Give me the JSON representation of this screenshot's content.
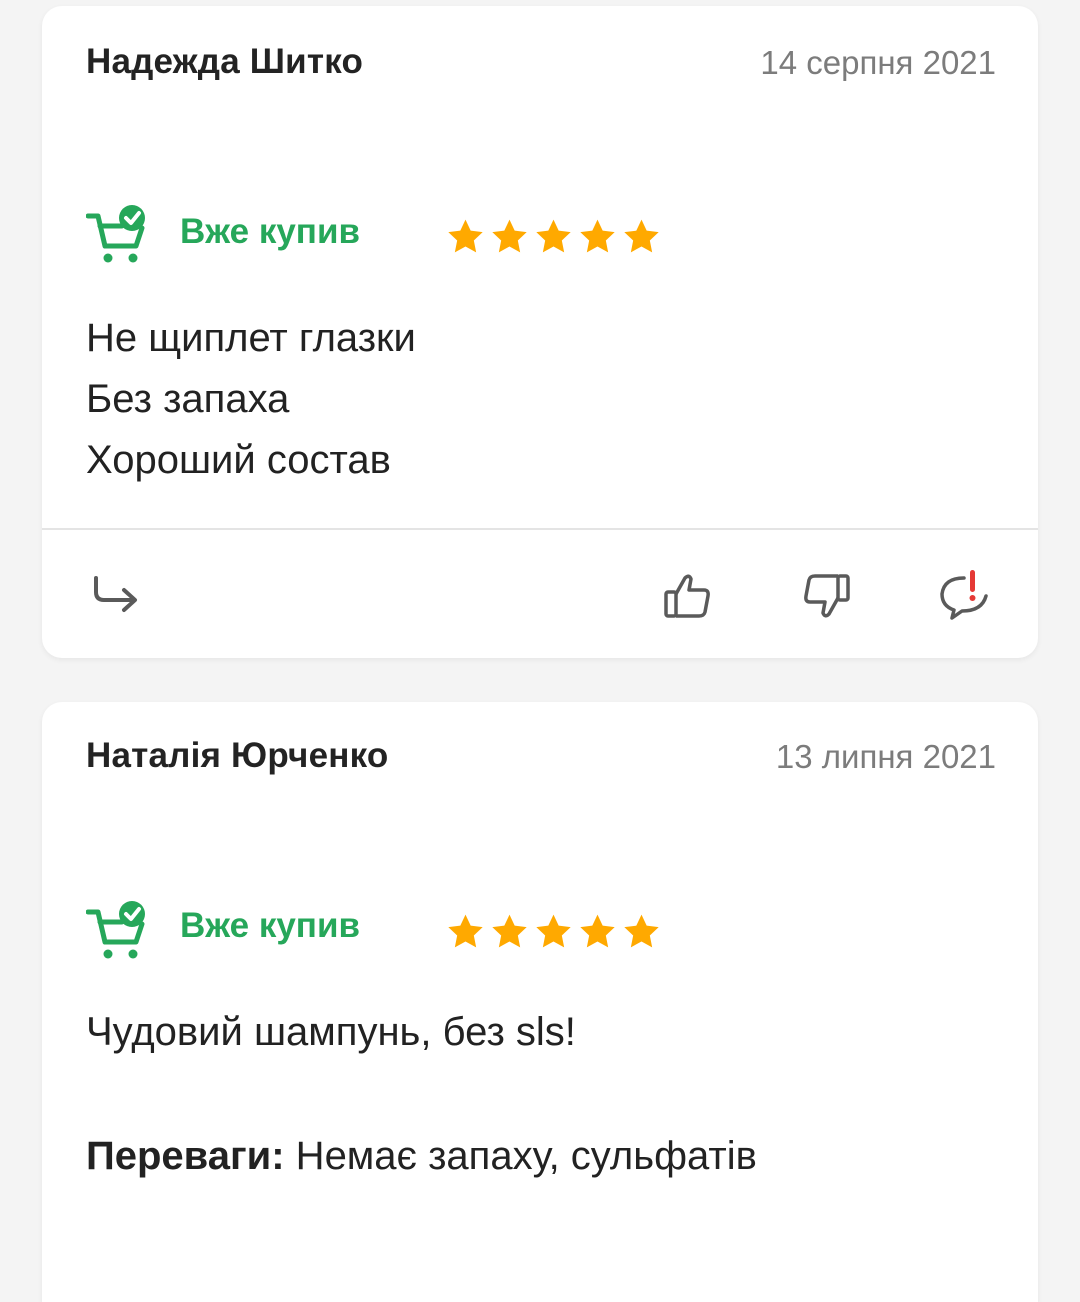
{
  "reviews": [
    {
      "author": "Надежда Шитко",
      "date": "14 серпня 2021",
      "badge": "Вже купив",
      "rating": 5,
      "lines": [
        "Не щиплет глазки",
        "Без запаха",
        "Хороший состав"
      ]
    },
    {
      "author": "Наталія Юрченко",
      "date": "13 липня 2021",
      "badge": "Вже купив",
      "rating": 5,
      "lines": [
        "Чудовий шампунь, без sls!"
      ],
      "pros_label": "Переваги:",
      "pros_text": " Немає запаху, сульфатів"
    }
  ],
  "icons": {
    "cart": "cart-check-icon",
    "reply": "reply-arrow-icon",
    "like": "thumbs-up-icon",
    "dislike": "thumbs-down-icon",
    "report": "report-icon"
  },
  "colors": {
    "accent_green": "#26a75a",
    "star": "#ffa900",
    "alert_red": "#e53935",
    "muted": "#7c7c7c"
  }
}
